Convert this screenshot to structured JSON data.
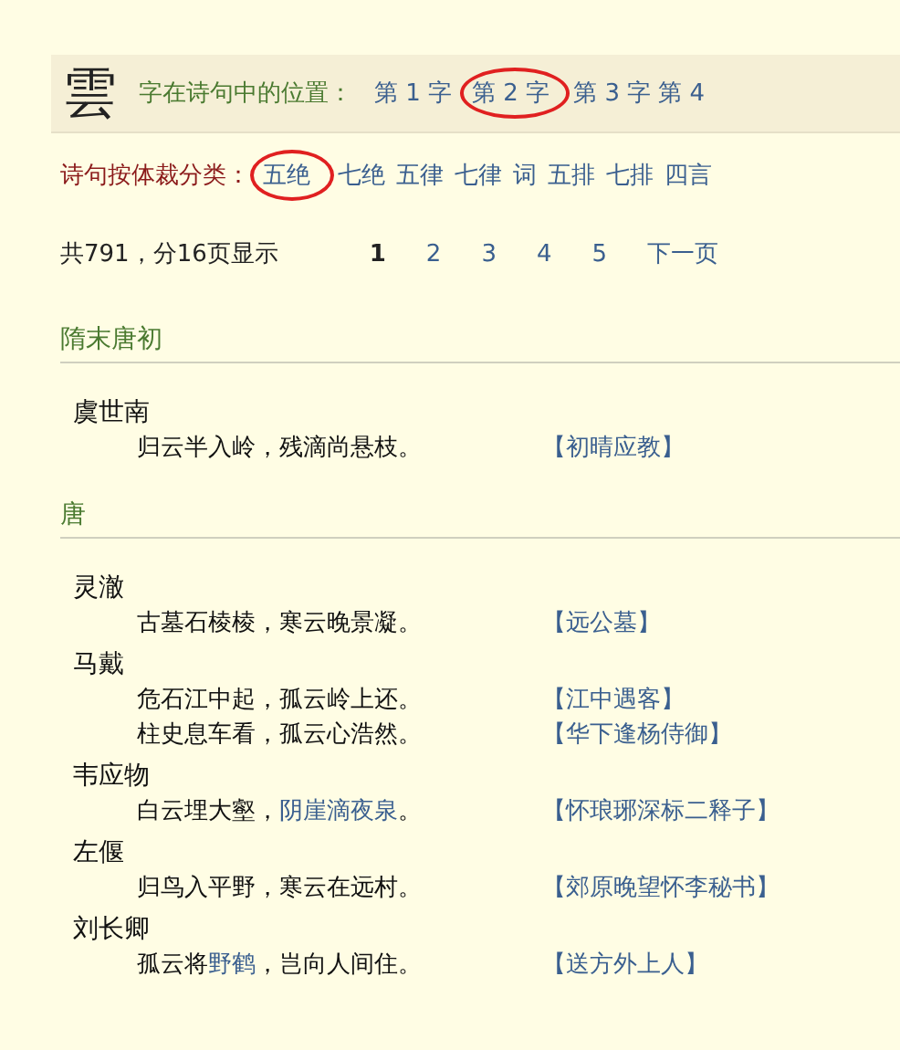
{
  "header": {
    "character": "雲",
    "position_label": "字在诗句中的位置：",
    "positions": [
      "第 1 字",
      "第 2 字",
      "第 3 字",
      "第 4"
    ]
  },
  "genres": {
    "label": "诗句按体裁分类：",
    "items": [
      "五绝",
      "七绝",
      "五律",
      "七律",
      "词",
      "五排",
      "七排",
      "四言"
    ]
  },
  "pager": {
    "summary": "共791，分16页显示",
    "pages": [
      {
        "label": "1",
        "selected": true
      },
      {
        "label": "2",
        "selected": false
      },
      {
        "label": "3",
        "selected": false
      },
      {
        "label": "4",
        "selected": false
      },
      {
        "label": "5",
        "selected": false
      }
    ],
    "next": "下一页"
  },
  "sections": [
    {
      "title": "隋末唐初",
      "poets": [
        {
          "name": "虞世南",
          "lines": [
            {
              "parts": [
                {
                  "text": "归云半入岭，残滴尚悬枝。",
                  "link": false
                }
              ],
              "title": "【初晴应教】"
            }
          ]
        }
      ]
    },
    {
      "title": "唐",
      "poets": [
        {
          "name": "灵澈",
          "lines": [
            {
              "parts": [
                {
                  "text": "古墓石棱棱，寒云晚景凝。",
                  "link": false
                }
              ],
              "title": "【远公墓】"
            }
          ]
        },
        {
          "name": "马戴",
          "lines": [
            {
              "parts": [
                {
                  "text": "危石江中起，孤云岭上还。",
                  "link": false
                }
              ],
              "title": "【江中遇客】"
            },
            {
              "parts": [
                {
                  "text": "柱史息车看，孤云心浩然。",
                  "link": false
                }
              ],
              "title": "【华下逢杨侍御】"
            }
          ]
        },
        {
          "name": "韦应物",
          "lines": [
            {
              "parts": [
                {
                  "text": "白云埋大壑，",
                  "link": false
                },
                {
                  "text": "阴崖滴夜泉",
                  "link": true
                },
                {
                  "text": "。",
                  "link": false
                }
              ],
              "title": "【怀琅琊深标二释子】"
            }
          ]
        },
        {
          "name": "左偃",
          "lines": [
            {
              "parts": [
                {
                  "text": "归鸟入平野，寒云在远村。",
                  "link": false
                }
              ],
              "title": "【郊原晚望怀李秘书】"
            }
          ]
        },
        {
          "name": "刘长卿",
          "lines": [
            {
              "parts": [
                {
                  "text": "孤云将",
                  "link": false
                },
                {
                  "text": "野鹤",
                  "link": true
                },
                {
                  "text": "，岂向人间住。",
                  "link": false
                }
              ],
              "title": "【送方外上人】"
            }
          ]
        }
      ]
    }
  ]
}
